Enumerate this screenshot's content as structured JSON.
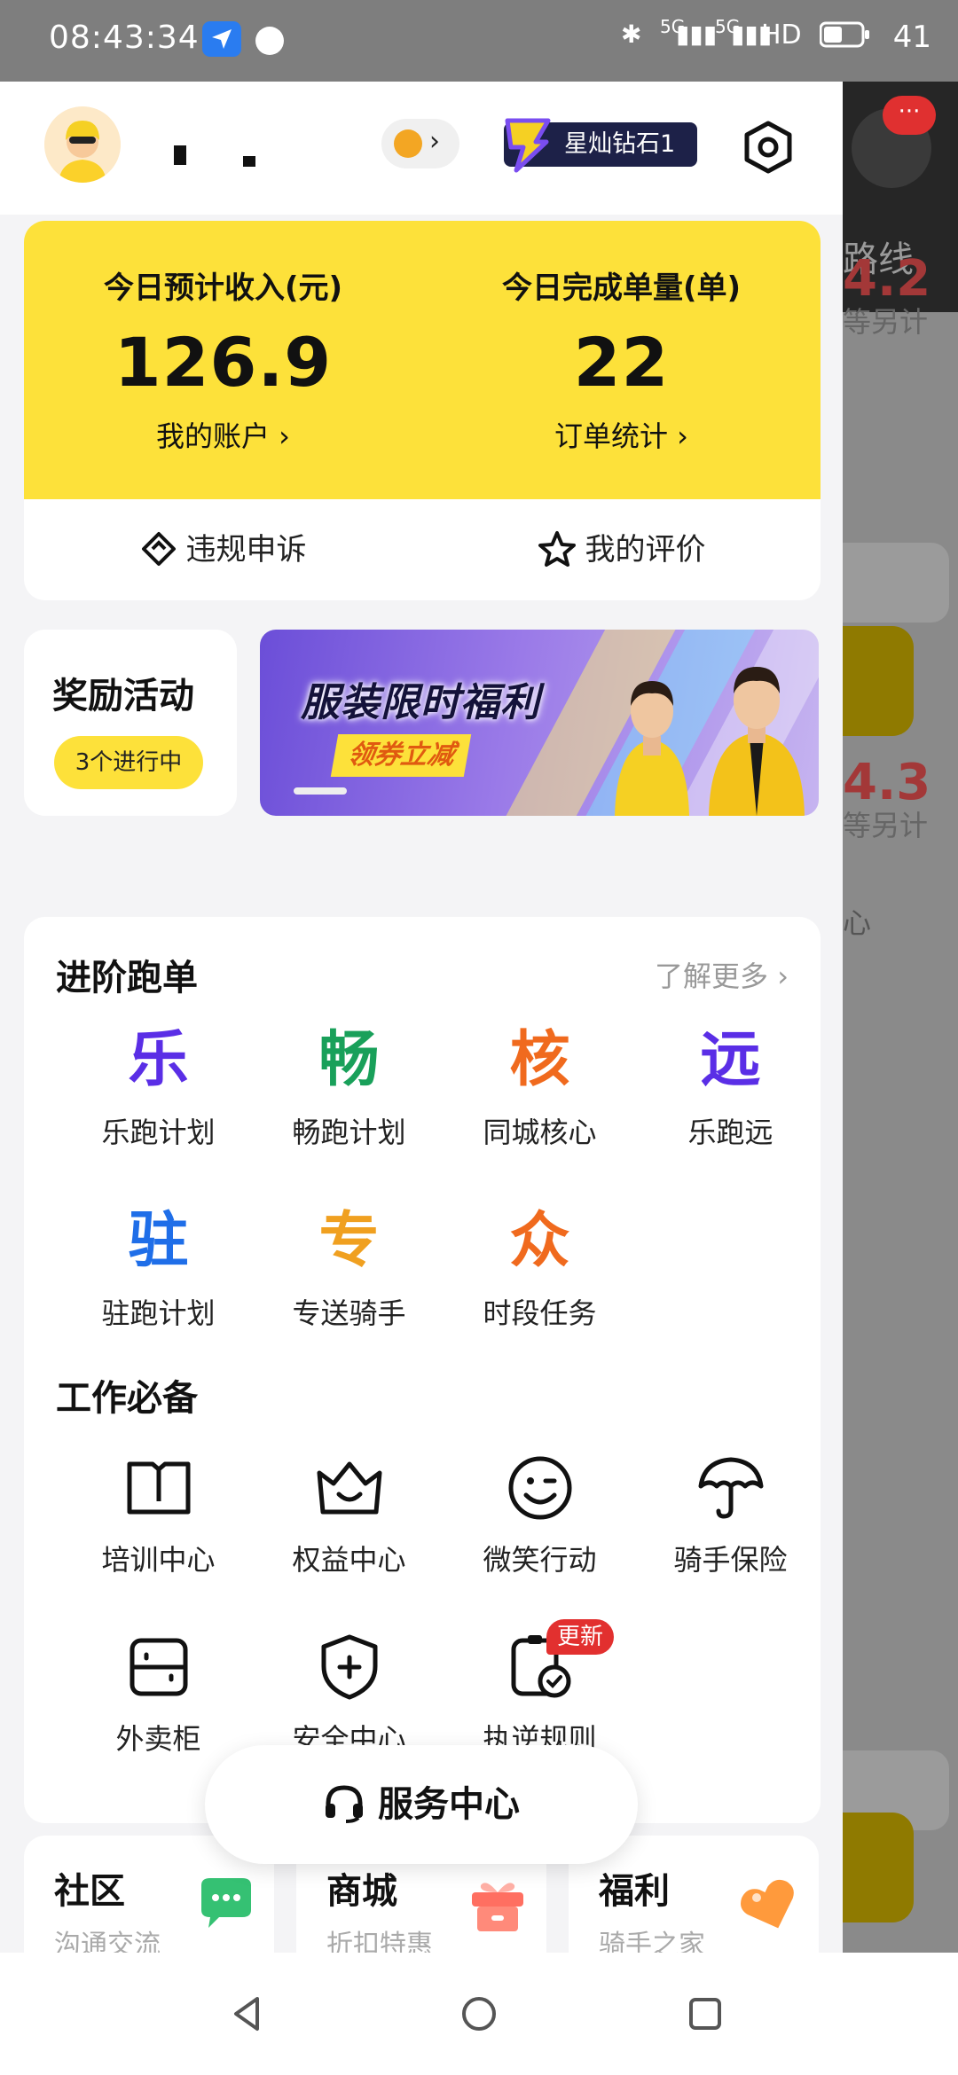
{
  "status_bar": {
    "time": "08:43:34",
    "network": "5G",
    "network2": "5G",
    "hd": "HD",
    "battery": "41"
  },
  "background_page": {
    "badge": "···",
    "route_label": "路线",
    "value_1": "4.2",
    "sub_1": "等另计",
    "value_2": "4.3",
    "sub_2": "等另计",
    "center_label": "心"
  },
  "profile": {
    "vip_label": "星灿钻石1"
  },
  "earnings": {
    "income_label": "今日预计收入(元)",
    "income_value": "126.9",
    "account_link": "我的账户 ›",
    "orders_label": "今日完成单量(单)",
    "orders_value": "22",
    "orders_link": "订单统计 ›",
    "appeal_label": "违规申诉",
    "rating_label": "我的评价"
  },
  "reward": {
    "title": "奖励活动",
    "ongoing": "3个进行中",
    "banner_title": "服装限时福利",
    "banner_sub": "领券立减"
  },
  "advanced": {
    "title": "进阶跑单",
    "more": "了解更多 ›",
    "items": [
      {
        "glyph": "乐",
        "label": "乐跑计划",
        "color": "#5a2ee6"
      },
      {
        "glyph": "畅",
        "label": "畅跑计划",
        "color": "#19a05a"
      },
      {
        "glyph": "核",
        "label": "同城核心",
        "color": "#f06a1e"
      },
      {
        "glyph": "远",
        "label": "乐跑远",
        "color": "#5a2ee6"
      },
      {
        "glyph": "驻",
        "label": "驻跑计划",
        "color": "#1f6ee8"
      },
      {
        "glyph": "专",
        "label": "专送骑手",
        "color": "#f0a020"
      },
      {
        "glyph": "众",
        "label": "时段任务",
        "color": "#f06a1e"
      }
    ]
  },
  "work": {
    "title": "工作必备",
    "items": [
      {
        "icon": "book-icon",
        "label": "培训中心"
      },
      {
        "icon": "crown-icon",
        "label": "权益中心"
      },
      {
        "icon": "smile-icon",
        "label": "微笑行动"
      },
      {
        "icon": "umbrella-icon",
        "label": "骑手保险"
      },
      {
        "icon": "locker-icon",
        "label": "外卖柜"
      },
      {
        "icon": "shield-icon",
        "label": "安全中心"
      },
      {
        "icon": "clock-check-icon",
        "label": "执逆规则",
        "badge": "更新"
      }
    ]
  },
  "service_center": {
    "label": "服务中心"
  },
  "bottom_cards": [
    {
      "title": "社区",
      "sub": "沟通交流",
      "icon": "chat-icon"
    },
    {
      "title": "商城",
      "sub": "折扣特惠",
      "icon": "gift-icon"
    },
    {
      "title": "福利",
      "sub": "骑手之家",
      "icon": "heart-icon"
    }
  ],
  "colors": {
    "accent_yellow": "#fde13a",
    "vip_bg": "#1d2148",
    "badge_red": "#e2302f"
  }
}
